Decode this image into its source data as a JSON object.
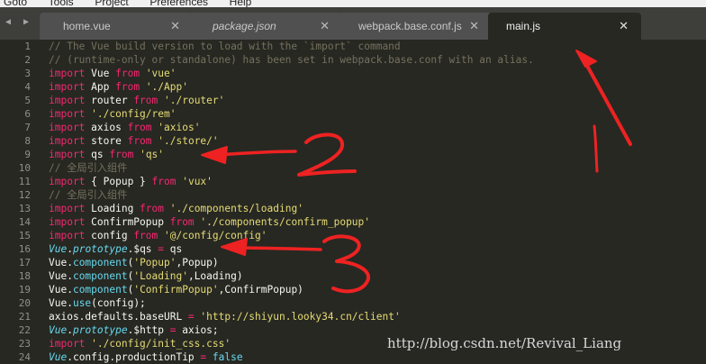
{
  "menubar": {
    "items": [
      "Goto",
      "Tools",
      "Project",
      "Preferences",
      "Help"
    ]
  },
  "tabs": [
    {
      "label": "home.vue",
      "close": "✕"
    },
    {
      "label": "package.json",
      "close": "✕"
    },
    {
      "label": "webpack.base.conf.js",
      "close": "✕"
    },
    {
      "label": "main.js",
      "close": "✕"
    }
  ],
  "nav": {
    "back": "◀",
    "forward": "▶"
  },
  "editor": {
    "line_numbers": [
      "1",
      "2",
      "3",
      "4",
      "5",
      "6",
      "7",
      "8",
      "9",
      "10",
      "11",
      "12",
      "13",
      "14",
      "15",
      "16",
      "17",
      "18",
      "19",
      "20",
      "21",
      "22",
      "23",
      "24"
    ],
    "lines": [
      [
        {
          "t": "// The Vue build version to load with the `import` command",
          "c": "c"
        }
      ],
      [
        {
          "t": "// (runtime-only or standalone) has been set in webpack.base.conf with an alias.",
          "c": "c"
        }
      ],
      [
        {
          "t": "import",
          "c": "k"
        },
        {
          "t": " Vue ",
          "c": ""
        },
        {
          "t": "from",
          "c": "k"
        },
        {
          "t": " ",
          "c": ""
        },
        {
          "t": "'vue'",
          "c": "s"
        }
      ],
      [
        {
          "t": "import",
          "c": "k"
        },
        {
          "t": " App ",
          "c": ""
        },
        {
          "t": "from",
          "c": "k"
        },
        {
          "t": " ",
          "c": ""
        },
        {
          "t": "'./App'",
          "c": "s"
        }
      ],
      [
        {
          "t": "import",
          "c": "k"
        },
        {
          "t": " router ",
          "c": ""
        },
        {
          "t": "from",
          "c": "k"
        },
        {
          "t": " ",
          "c": ""
        },
        {
          "t": "'./router'",
          "c": "s"
        }
      ],
      [
        {
          "t": "import",
          "c": "k"
        },
        {
          "t": " ",
          "c": ""
        },
        {
          "t": "'./config/rem'",
          "c": "s"
        }
      ],
      [
        {
          "t": "import",
          "c": "k"
        },
        {
          "t": " axios ",
          "c": ""
        },
        {
          "t": "from",
          "c": "k"
        },
        {
          "t": " ",
          "c": ""
        },
        {
          "t": "'axios'",
          "c": "s"
        }
      ],
      [
        {
          "t": "import",
          "c": "k"
        },
        {
          "t": " store ",
          "c": ""
        },
        {
          "t": "from",
          "c": "k"
        },
        {
          "t": " ",
          "c": ""
        },
        {
          "t": "'./store/'",
          "c": "s"
        }
      ],
      [
        {
          "t": "import",
          "c": "k"
        },
        {
          "t": " qs ",
          "c": ""
        },
        {
          "t": "from",
          "c": "k"
        },
        {
          "t": " ",
          "c": ""
        },
        {
          "t": "'qs'",
          "c": "s"
        }
      ],
      [
        {
          "t": "// 全局引入组件",
          "c": "c"
        }
      ],
      [
        {
          "t": "import",
          "c": "k"
        },
        {
          "t": " { Popup } ",
          "c": ""
        },
        {
          "t": "from",
          "c": "k"
        },
        {
          "t": " ",
          "c": ""
        },
        {
          "t": "'vux'",
          "c": "s"
        }
      ],
      [
        {
          "t": "// 全局引入组件",
          "c": "c"
        }
      ],
      [
        {
          "t": "import",
          "c": "k"
        },
        {
          "t": " Loading ",
          "c": ""
        },
        {
          "t": "from",
          "c": "k"
        },
        {
          "t": " ",
          "c": ""
        },
        {
          "t": "'./components/loading'",
          "c": "s"
        }
      ],
      [
        {
          "t": "import",
          "c": "k"
        },
        {
          "t": " ConfirmPopup ",
          "c": ""
        },
        {
          "t": "from",
          "c": "k"
        },
        {
          "t": " ",
          "c": ""
        },
        {
          "t": "'./components/confirm_popup'",
          "c": "s"
        }
      ],
      [
        {
          "t": "import",
          "c": "k"
        },
        {
          "t": " config ",
          "c": ""
        },
        {
          "t": "from",
          "c": "k"
        },
        {
          "t": " ",
          "c": ""
        },
        {
          "t": "'@/config/config'",
          "c": "s"
        }
      ],
      [
        {
          "t": "Vue",
          "c": "t"
        },
        {
          "t": ".",
          "c": ""
        },
        {
          "t": "prototype",
          "c": "t"
        },
        {
          "t": ".$qs ",
          "c": ""
        },
        {
          "t": "=",
          "c": "k"
        },
        {
          "t": " qs",
          "c": ""
        }
      ],
      [
        {
          "t": "Vue.",
          "c": ""
        },
        {
          "t": "component",
          "c": "f"
        },
        {
          "t": "(",
          "c": ""
        },
        {
          "t": "'Popup'",
          "c": "s"
        },
        {
          "t": ",Popup)",
          "c": ""
        }
      ],
      [
        {
          "t": "Vue.",
          "c": ""
        },
        {
          "t": "component",
          "c": "f"
        },
        {
          "t": "(",
          "c": ""
        },
        {
          "t": "'Loading'",
          "c": "s"
        },
        {
          "t": ",Loading)",
          "c": ""
        }
      ],
      [
        {
          "t": "Vue.",
          "c": ""
        },
        {
          "t": "component",
          "c": "f"
        },
        {
          "t": "(",
          "c": ""
        },
        {
          "t": "'ConfirmPopup'",
          "c": "s"
        },
        {
          "t": ",ConfirmPopup)",
          "c": ""
        }
      ],
      [
        {
          "t": "Vue.",
          "c": ""
        },
        {
          "t": "use",
          "c": "f"
        },
        {
          "t": "(config);",
          "c": ""
        }
      ],
      [
        {
          "t": "axios.defaults.baseURL ",
          "c": ""
        },
        {
          "t": "=",
          "c": "k"
        },
        {
          "t": " ",
          "c": ""
        },
        {
          "t": "'http://shiyun.looky34.cn/client'",
          "c": "s"
        }
      ],
      [
        {
          "t": "Vue",
          "c": "t"
        },
        {
          "t": ".",
          "c": ""
        },
        {
          "t": "prototype",
          "c": "t"
        },
        {
          "t": ".$http ",
          "c": ""
        },
        {
          "t": "=",
          "c": "k"
        },
        {
          "t": " axios;",
          "c": ""
        }
      ],
      [
        {
          "t": "import",
          "c": "k"
        },
        {
          "t": " ",
          "c": ""
        },
        {
          "t": "'./config/init_css.css'",
          "c": "s"
        }
      ],
      [
        {
          "t": "Vue",
          "c": "t"
        },
        {
          "t": ".config.productionTip ",
          "c": ""
        },
        {
          "t": "=",
          "c": "k"
        },
        {
          "t": " ",
          "c": ""
        },
        {
          "t": "false",
          "c": "f"
        }
      ]
    ]
  },
  "watermark": "http://blog.csdn.net/Revival_Liang",
  "colors": {
    "background": "#272822",
    "keyword": "#f92672",
    "string": "#e6db74",
    "comment": "#75715e",
    "function": "#66d9ef",
    "annotation": "#ee2222"
  }
}
